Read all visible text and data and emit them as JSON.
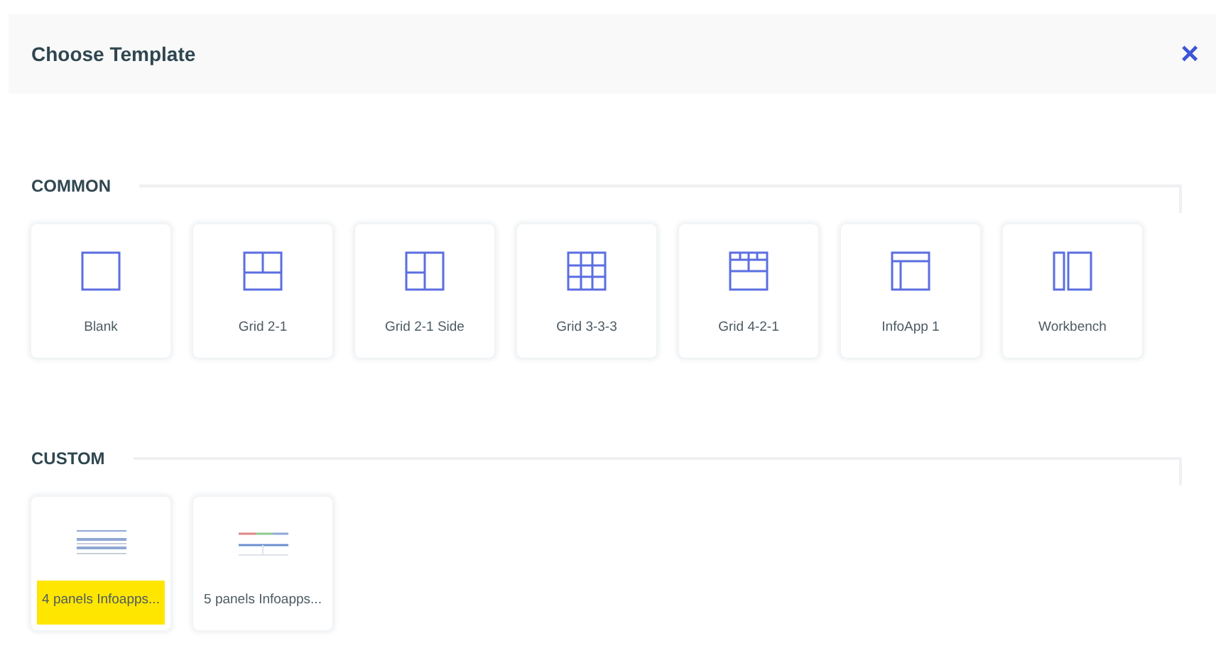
{
  "dialog": {
    "title": "Choose Template",
    "close": "×"
  },
  "sections": [
    {
      "title": "COMMON",
      "templates": [
        {
          "label": "Blank",
          "kind": "blank",
          "highlighted": false
        },
        {
          "label": "Grid 2-1",
          "kind": "grid21",
          "highlighted": false
        },
        {
          "label": "Grid 2-1 Side",
          "kind": "grid21side",
          "highlighted": false
        },
        {
          "label": "Grid 3-3-3",
          "kind": "grid333",
          "highlighted": false
        },
        {
          "label": "Grid 4-2-1",
          "kind": "grid421",
          "highlighted": false
        },
        {
          "label": "InfoApp 1",
          "kind": "infoapp",
          "highlighted": false
        },
        {
          "label": "Workbench",
          "kind": "workbench",
          "highlighted": false
        }
      ]
    },
    {
      "title": "CUSTOM",
      "templates": [
        {
          "label": "4 panels Infoapps...",
          "kind": "custom4",
          "highlighted": true
        },
        {
          "label": "5 panels Infoapps...",
          "kind": "custom5",
          "highlighted": false
        }
      ]
    }
  ]
}
